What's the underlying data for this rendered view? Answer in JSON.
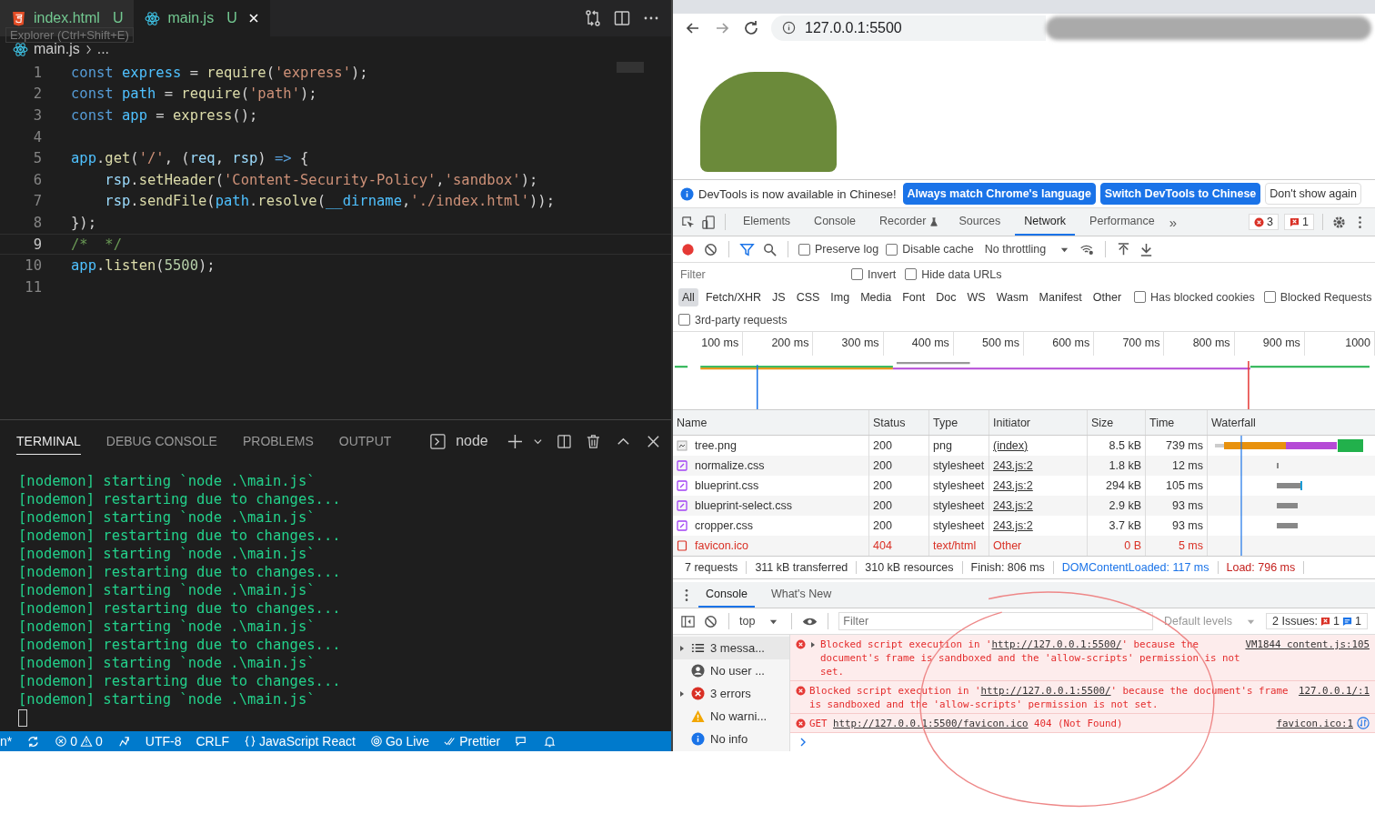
{
  "editor": {
    "tabs": [
      {
        "label": "index.html",
        "status": "U",
        "kind": "html",
        "selected": false
      },
      {
        "label": "main.js",
        "status": "U",
        "kind": "react",
        "selected": true
      }
    ],
    "tooltip": "Explorer (Ctrl+Shift+E)",
    "breadcrumb": [
      "main.js",
      "..."
    ],
    "lines": [
      {
        "number": "1",
        "current": false,
        "tokens": [
          {
            "kind": "keyword",
            "text": "const "
          },
          {
            "kind": "variable",
            "text": "express"
          },
          {
            "kind": "punct",
            "text": " = "
          },
          {
            "kind": "function",
            "text": "require"
          },
          {
            "kind": "punct",
            "text": "("
          },
          {
            "kind": "string",
            "text": "'express'"
          },
          {
            "kind": "punct",
            "text": ");"
          }
        ]
      },
      {
        "number": "2",
        "current": false,
        "tokens": [
          {
            "kind": "keyword",
            "text": "const "
          },
          {
            "kind": "variable",
            "text": "path"
          },
          {
            "kind": "punct",
            "text": " = "
          },
          {
            "kind": "function",
            "text": "require"
          },
          {
            "kind": "punct",
            "text": "("
          },
          {
            "kind": "string",
            "text": "'path'"
          },
          {
            "kind": "punct",
            "text": ");"
          }
        ]
      },
      {
        "number": "3",
        "current": false,
        "tokens": [
          {
            "kind": "keyword",
            "text": "const "
          },
          {
            "kind": "variable",
            "text": "app"
          },
          {
            "kind": "punct",
            "text": " = "
          },
          {
            "kind": "function",
            "text": "express"
          },
          {
            "kind": "punct",
            "text": "();"
          }
        ]
      },
      {
        "number": "4",
        "current": false
      },
      {
        "number": "5",
        "current": false,
        "tokens": [
          {
            "kind": "variable",
            "text": "app"
          },
          {
            "kind": "punct",
            "text": "."
          },
          {
            "kind": "function",
            "text": "get"
          },
          {
            "kind": "punct",
            "text": "("
          },
          {
            "kind": "string",
            "text": "'/'"
          },
          {
            "kind": "punct",
            "text": ", ("
          },
          {
            "kind": "param",
            "text": "req"
          },
          {
            "kind": "punct",
            "text": ", "
          },
          {
            "kind": "param",
            "text": "rsp"
          },
          {
            "kind": "punct",
            "text": ") "
          },
          {
            "kind": "keyword",
            "text": "=>"
          },
          {
            "kind": "punct",
            "text": " {"
          }
        ]
      },
      {
        "number": "6",
        "current": false,
        "indent": true,
        "tokens": [
          {
            "kind": "param",
            "text": "rsp"
          },
          {
            "kind": "punct",
            "text": "."
          },
          {
            "kind": "function",
            "text": "setHeader"
          },
          {
            "kind": "punct",
            "text": "("
          },
          {
            "kind": "string",
            "text": "'Content-Security-Policy'"
          },
          {
            "kind": "punct",
            "text": ","
          },
          {
            "kind": "string",
            "text": "'sandbox'"
          },
          {
            "kind": "punct",
            "text": ");"
          }
        ]
      },
      {
        "number": "7",
        "current": false,
        "indent": true,
        "tokens": [
          {
            "kind": "param",
            "text": "rsp"
          },
          {
            "kind": "punct",
            "text": "."
          },
          {
            "kind": "function",
            "text": "sendFile"
          },
          {
            "kind": "punct",
            "text": "("
          },
          {
            "kind": "variable",
            "text": "path"
          },
          {
            "kind": "punct",
            "text": "."
          },
          {
            "kind": "function",
            "text": "resolve"
          },
          {
            "kind": "punct",
            "text": "("
          },
          {
            "kind": "variable",
            "text": "__dirname"
          },
          {
            "kind": "punct",
            "text": ","
          },
          {
            "kind": "string",
            "text": "'./index.html'"
          },
          {
            "kind": "punct",
            "text": "));"
          }
        ]
      },
      {
        "number": "8",
        "current": false,
        "tokens": [
          {
            "kind": "punct",
            "text": "});"
          }
        ]
      },
      {
        "number": "9",
        "current": true,
        "tokens": [
          {
            "kind": "comment",
            "text": "/*  */"
          }
        ]
      },
      {
        "number": "10",
        "current": false,
        "tokens": [
          {
            "kind": "variable",
            "text": "app"
          },
          {
            "kind": "punct",
            "text": "."
          },
          {
            "kind": "function",
            "text": "listen"
          },
          {
            "kind": "punct",
            "text": "("
          },
          {
            "kind": "number",
            "text": "5500"
          },
          {
            "kind": "punct",
            "text": ");"
          }
        ]
      },
      {
        "number": "11",
        "current": false
      }
    ]
  },
  "panel": {
    "tabs": [
      {
        "label": "TERMINAL",
        "selected": true
      },
      {
        "label": "DEBUG CONSOLE",
        "selected": false
      },
      {
        "label": "PROBLEMS",
        "selected": false
      },
      {
        "label": "OUTPUT",
        "selected": false
      }
    ],
    "shell": "node",
    "lines": [
      "[nodemon] starting `node .\\main.js`",
      "[nodemon] restarting due to changes...",
      "[nodemon] starting `node .\\main.js`",
      "[nodemon] restarting due to changes...",
      "[nodemon] starting `node .\\main.js`",
      "[nodemon] restarting due to changes...",
      "[nodemon] starting `node .\\main.js`",
      "[nodemon] restarting due to changes...",
      "[nodemon] starting `node .\\main.js`",
      "[nodemon] restarting due to changes...",
      "[nodemon] starting `node .\\main.js`",
      "[nodemon] restarting due to changes...",
      "[nodemon] starting `node .\\main.js`"
    ]
  },
  "status_bar": [
    {
      "kind": "text",
      "text": "n*"
    },
    {
      "kind": "sync"
    },
    {
      "kind": "problems",
      "errors": "0",
      "warnings": "0"
    },
    {
      "kind": "share"
    },
    {
      "kind": "text",
      "text": "UTF-8"
    },
    {
      "kind": "text",
      "text": "CRLF"
    },
    {
      "kind": "lang",
      "text": "JavaScript React"
    },
    {
      "kind": "golive",
      "text": "Go Live"
    },
    {
      "kind": "prettier",
      "text": "Prettier"
    },
    {
      "kind": "feedback"
    },
    {
      "kind": "bell"
    }
  ],
  "browser": {
    "address": "127.0.0.1:5500"
  },
  "devtools": {
    "infobar": {
      "text": "DevTools is now available in Chinese!",
      "buttons": [
        {
          "label": "Always match Chrome's language",
          "primary": true
        },
        {
          "label": "Switch DevTools to Chinese",
          "primary": true
        },
        {
          "label": "Don't show again",
          "primary": false
        }
      ]
    },
    "tabs": [
      {
        "label": "Elements",
        "selected": false
      },
      {
        "label": "Console",
        "selected": false
      },
      {
        "label": "Recorder",
        "selected": false
      },
      {
        "label": "Sources",
        "selected": false
      },
      {
        "label": "Network",
        "selected": true
      },
      {
        "label": "Performance",
        "selected": false
      }
    ],
    "more": "»",
    "errors": "3",
    "issues": "1",
    "network": {
      "checkboxes": [
        {
          "label": "Preserve log",
          "checked": false
        },
        {
          "label": "Disable cache",
          "checked": false
        }
      ],
      "throttling": "No throttling",
      "filter": {
        "placeholder": "Filter"
      },
      "filter_checks": [
        {
          "label": "Invert",
          "checked": false
        },
        {
          "label": "Hide data URLs",
          "checked": false
        }
      ],
      "types": [
        {
          "label": "All",
          "selected": true
        },
        {
          "label": "Fetch/XHR",
          "selected": false
        },
        {
          "label": "JS",
          "selected": false
        },
        {
          "label": "CSS",
          "selected": false
        },
        {
          "label": "Img",
          "selected": false
        },
        {
          "label": "Media",
          "selected": false
        },
        {
          "label": "Font",
          "selected": false
        },
        {
          "label": "Doc",
          "selected": false
        },
        {
          "label": "WS",
          "selected": false
        },
        {
          "label": "Wasm",
          "selected": false
        },
        {
          "label": "Manifest",
          "selected": false
        },
        {
          "label": "Other",
          "selected": false
        }
      ],
      "type_checks": [
        {
          "label": "Has blocked cookies",
          "checked": false
        },
        {
          "label": "Blocked Requests",
          "checked": false
        }
      ],
      "third_party": {
        "label": "3rd-party requests",
        "checked": false
      },
      "timeline_ticks": [
        "100 ms",
        "200 ms",
        "300 ms",
        "400 ms",
        "500 ms",
        "600 ms",
        "700 ms",
        "800 ms",
        "900 ms",
        "1000"
      ],
      "columns": [
        "Name",
        "Status",
        "Type",
        "Initiator",
        "Size",
        "Time",
        "Waterfall"
      ],
      "rows": [
        {
          "kind": "image",
          "name": "tree.png",
          "status": "200",
          "type": "png",
          "initiator": "(index)",
          "linked": true,
          "size": "8.5 kB",
          "time": "739 ms",
          "failed": false
        },
        {
          "kind": "stylesheet",
          "name": "normalize.css",
          "status": "200",
          "type": "stylesheet",
          "initiator": "243.js:2",
          "linked": true,
          "size": "1.8 kB",
          "time": "12 ms",
          "failed": false
        },
        {
          "kind": "stylesheet",
          "name": "blueprint.css",
          "status": "200",
          "type": "stylesheet",
          "initiator": "243.js:2",
          "linked": true,
          "size": "294 kB",
          "time": "105 ms",
          "failed": false
        },
        {
          "kind": "stylesheet",
          "name": "blueprint-select.css",
          "status": "200",
          "type": "stylesheet",
          "initiator": "243.js:2",
          "linked": true,
          "size": "2.9 kB",
          "time": "93 ms",
          "failed": false
        },
        {
          "kind": "stylesheet",
          "name": "cropper.css",
          "status": "200",
          "type": "stylesheet",
          "initiator": "243.js:2",
          "linked": true,
          "size": "3.7 kB",
          "time": "93 ms",
          "failed": false
        },
        {
          "kind": "document",
          "name": "favicon.ico",
          "status": "404",
          "type": "text/html",
          "initiator": "Other",
          "linked": false,
          "size": "0 B",
          "time": "5 ms",
          "failed": true
        }
      ],
      "summary": [
        {
          "kind": "plain",
          "text": "7 requests"
        },
        {
          "kind": "plain",
          "text": "311 kB transferred"
        },
        {
          "kind": "plain",
          "text": "310 kB resources"
        },
        {
          "kind": "plain",
          "text": "Finish: 806 ms"
        },
        {
          "kind": "dom",
          "text": "DOMContentLoaded: 117 ms"
        },
        {
          "kind": "load",
          "text": "Load: 796 ms"
        }
      ]
    },
    "drawer": {
      "tabs": [
        {
          "label": "Console",
          "selected": true
        },
        {
          "label": "What's New",
          "selected": false
        }
      ],
      "context": "top",
      "filter": {
        "placeholder": "Filter"
      },
      "levels": "Default levels",
      "issues_label": "2 Issues:",
      "issue_errors": "1",
      "issue_info": "1",
      "sidebar": [
        {
          "kind": "list",
          "label": "3 messa...",
          "expandable": true,
          "selected": true
        },
        {
          "kind": "user",
          "label": "No user ...",
          "expandable": false,
          "selected": false
        },
        {
          "kind": "error",
          "label": "3 errors",
          "expandable": true,
          "selected": false
        },
        {
          "kind": "warning",
          "label": "No warni...",
          "expandable": false,
          "selected": false
        },
        {
          "kind": "info",
          "label": "No info",
          "expandable": false,
          "selected": false
        }
      ],
      "messages": [
        {
          "expandable": true,
          "prefix": "Blocked script execution in '",
          "url": "http://127.0.0.1:5500/",
          "suffix": "' because the document's frame is sandboxed and the 'allow-scripts' permission is not set.",
          "source": "VM1844 content.js:105"
        },
        {
          "expandable": false,
          "prefix": "Blocked script execution in '",
          "url": "http://127.0.0.1:5500/",
          "suffix": "' because the document's frame is sandboxed and the 'allow-scripts' permission is not set.",
          "source": "127.0.0.1/:1"
        },
        {
          "expandable": false,
          "prefix": "GET ",
          "url": "http://127.0.0.1:5500/favicon.ico",
          "suffix": " 404 (Not Found)",
          "source": "favicon.ico:1"
        }
      ]
    }
  }
}
